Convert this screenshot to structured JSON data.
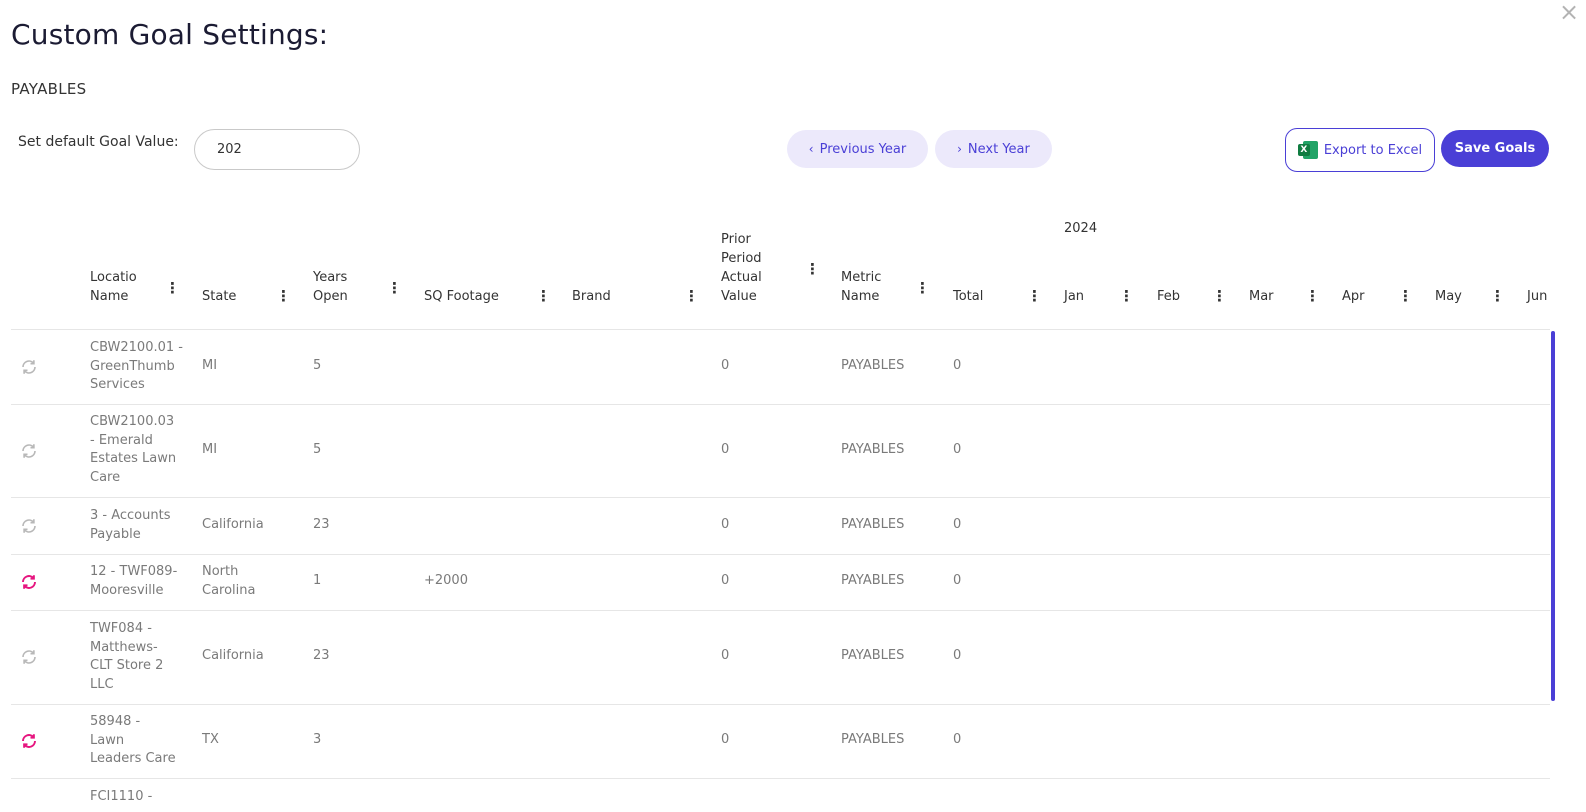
{
  "dialog": {
    "close_glyph": "×",
    "title": "Custom Goal Settings:",
    "subtitle": "PAYABLES"
  },
  "controls": {
    "goal_label": "Set default Goal Value:",
    "goal_value": "202",
    "prev_label": "Previous Year",
    "next_label": "Next Year",
    "export_label": "Export to Excel",
    "save_label": "Save Goals"
  },
  "table": {
    "year": "2024",
    "columns": {
      "location_l1": "Locatio",
      "location_l2": "Name",
      "state": "State",
      "years_l1": "Years",
      "years_l2": "Open",
      "sqft": "SQ Footage",
      "brand": "Brand",
      "prior_l1": "Prior",
      "prior_l2": "Period",
      "prior_l3": "Actual",
      "prior_l4": "Value",
      "metric_l1": "Metric",
      "metric_l2": "Name",
      "total": "Total",
      "jan": "Jan",
      "feb": "Feb",
      "mar": "Mar",
      "apr": "Apr",
      "may": "May",
      "jun": "Jun"
    },
    "rows": [
      {
        "loc1": "CBW2100.01 -",
        "loc2": "GreenThumb",
        "loc3": "Services",
        "loc4": "",
        "state1": "MI",
        "state2": "",
        "years": "5",
        "sqft": "",
        "brand": "",
        "prior": "0",
        "metric": "PAYABLES",
        "total": "0",
        "active": false
      },
      {
        "loc1": "CBW2100.03",
        "loc2": "- Emerald",
        "loc3": "Estates Lawn",
        "loc4": "Care",
        "state1": "MI",
        "state2": "",
        "years": "5",
        "sqft": "",
        "brand": "",
        "prior": "0",
        "metric": "PAYABLES",
        "total": "0",
        "active": false
      },
      {
        "loc1": "3 - Accounts",
        "loc2": "Payable",
        "loc3": "",
        "loc4": "",
        "state1": "California",
        "state2": "",
        "years": "23",
        "sqft": "",
        "brand": "",
        "prior": "0",
        "metric": "PAYABLES",
        "total": "0",
        "active": false
      },
      {
        "loc1": "12 - TWF089-",
        "loc2": "Mooresville",
        "loc3": "",
        "loc4": "",
        "state1": "North",
        "state2": "Carolina",
        "years": "1",
        "sqft": "+2000",
        "brand": "",
        "prior": "0",
        "metric": "PAYABLES",
        "total": "0",
        "active": true
      },
      {
        "loc1": "TWF084 -",
        "loc2": "Matthews-",
        "loc3": "CLT Store 2",
        "loc4": "LLC",
        "state1": "California",
        "state2": "",
        "years": "23",
        "sqft": "",
        "brand": "",
        "prior": "0",
        "metric": "PAYABLES",
        "total": "0",
        "active": false
      },
      {
        "loc1": "58948 -",
        "loc2": "Lawn",
        "loc3": "Leaders Care",
        "loc4": "",
        "state1": "TX",
        "state2": "",
        "years": "3",
        "sqft": "",
        "brand": "",
        "prior": "0",
        "metric": "PAYABLES",
        "total": "0",
        "active": true
      },
      {
        "loc1": "FCI1110 -",
        "loc2": "",
        "loc3": "",
        "loc4": "",
        "state1": "",
        "state2": "",
        "years": "",
        "sqft": "",
        "brand": "",
        "prior": "",
        "metric": "",
        "total": "",
        "active": false
      }
    ]
  },
  "colors": {
    "accent": "#4a3fd6",
    "refresh_active": "#e6157f",
    "refresh_inactive": "#b8b8b8"
  }
}
